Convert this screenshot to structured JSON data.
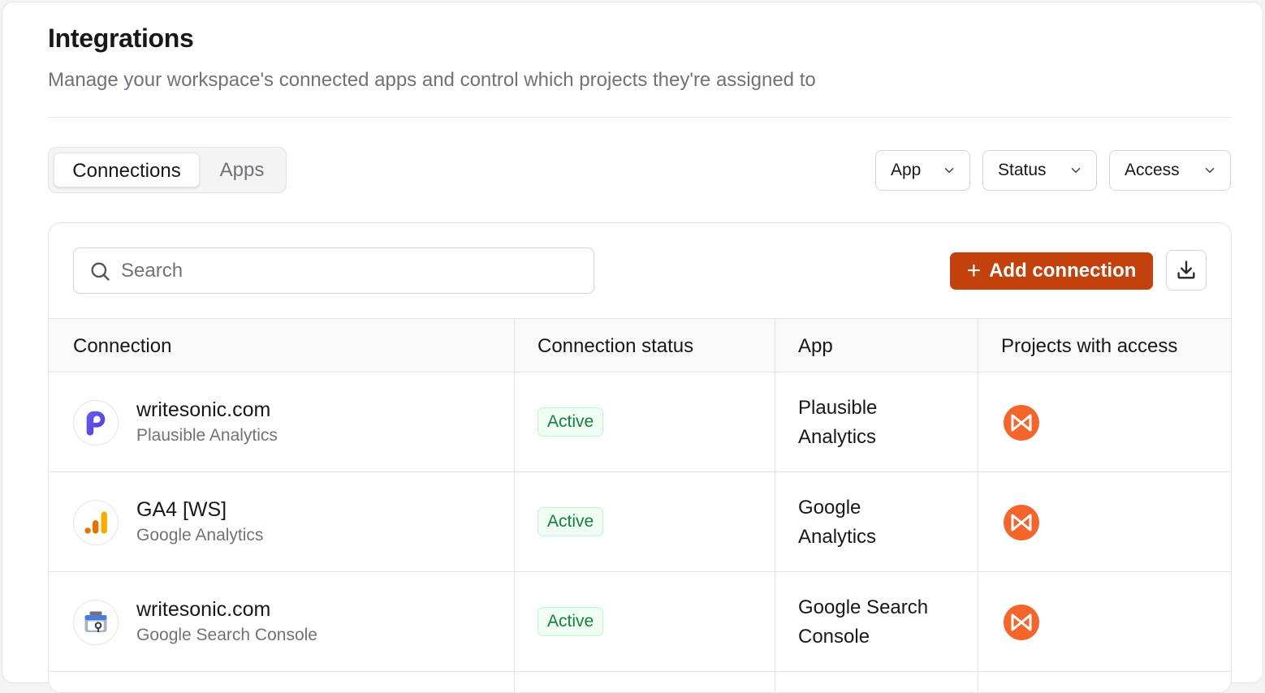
{
  "header": {
    "title": "Integrations",
    "subtitle": "Manage your workspace's connected apps and control which projects they're assigned to"
  },
  "tabs": [
    {
      "label": "Connections",
      "active": true
    },
    {
      "label": "Apps",
      "active": false
    }
  ],
  "filters": [
    {
      "label": "App"
    },
    {
      "label": "Status"
    },
    {
      "label": "Access"
    }
  ],
  "toolbar": {
    "search_placeholder": "Search",
    "add_label": "Add connection",
    "accent_color": "#c2410c"
  },
  "table": {
    "columns": [
      "Connection",
      "Connection status",
      "App",
      "Projects with access"
    ],
    "rows": [
      {
        "name": "writesonic.com",
        "sub": "Plausible Analytics",
        "status": "Active",
        "app_line1": "Plausible",
        "app_line2": "Analytics",
        "logo": "plausible-logo-icon"
      },
      {
        "name": "GA4 [WS]",
        "sub": "Google Analytics",
        "status": "Active",
        "app_line1": "Google",
        "app_line2": "Analytics",
        "logo": "google-analytics-logo-icon"
      },
      {
        "name": "writesonic.com",
        "sub": "Google Search Console",
        "status": "Active",
        "app_line1": "Google Search",
        "app_line2": "Console",
        "logo": "google-search-console-logo-icon"
      }
    ]
  }
}
